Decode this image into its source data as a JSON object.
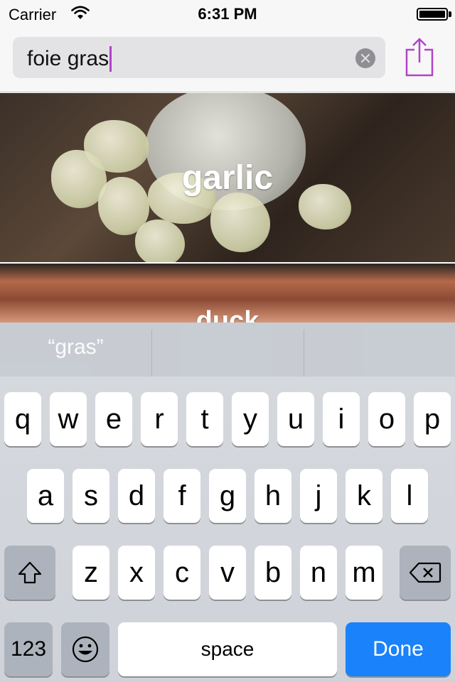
{
  "status_bar": {
    "carrier": "Carrier",
    "time": "6:31 PM"
  },
  "search": {
    "query": "foie gras"
  },
  "results": [
    {
      "title": "garlic"
    },
    {
      "title": "duck"
    }
  ],
  "keyboard": {
    "prediction": "“gras”",
    "row1": [
      "q",
      "w",
      "e",
      "r",
      "t",
      "y",
      "u",
      "i",
      "o",
      "p"
    ],
    "row2": [
      "a",
      "s",
      "d",
      "f",
      "g",
      "h",
      "j",
      "k",
      "l"
    ],
    "row3": [
      "z",
      "x",
      "c",
      "v",
      "b",
      "n",
      "m"
    ],
    "numbers_key": "123",
    "space_key": "space",
    "done_key": "Done"
  },
  "colors": {
    "accent": "#b044c8",
    "done_key": "#1a82fb"
  }
}
